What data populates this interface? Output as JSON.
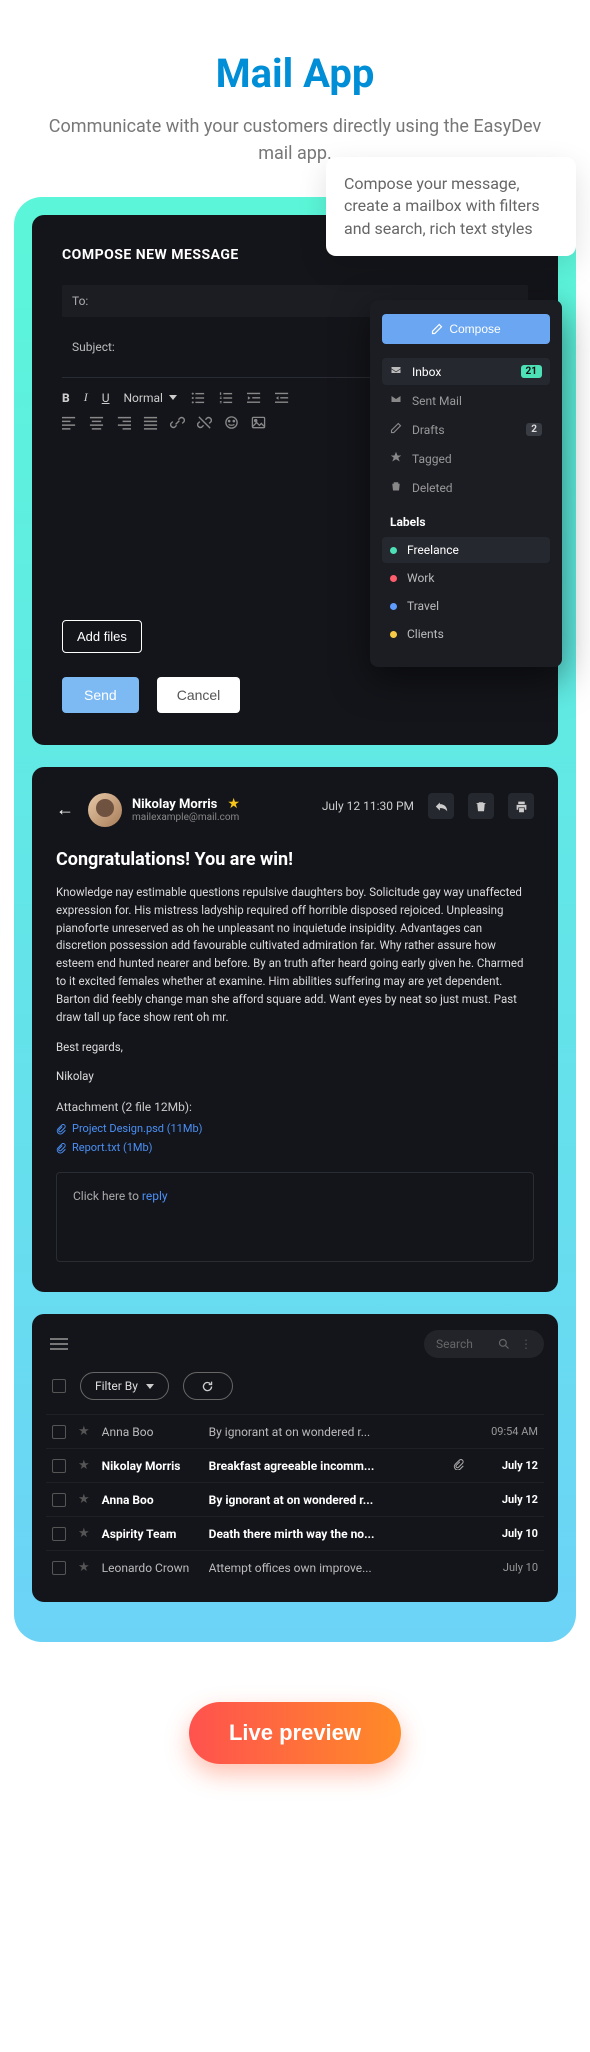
{
  "hero": {
    "title": "Mail App",
    "subtitle": "Communicate with your customers directly using the EasyDev mail app."
  },
  "tooltip": "Compose your message, create a mailbox with filters and search, rich text styles",
  "compose": {
    "heading": "COMPOSE NEW MESSAGE",
    "to_label": "To:",
    "subject_label": "Subject:",
    "format_select": "Normal",
    "add_files": "Add files",
    "send": "Send",
    "cancel": "Cancel"
  },
  "sidebar": {
    "compose_label": "Compose",
    "items": [
      {
        "label": "Inbox",
        "badge": "21",
        "badge_type": "green",
        "active": true
      },
      {
        "label": "Sent Mail"
      },
      {
        "label": "Drafts",
        "badge": "2",
        "badge_type": "gray"
      },
      {
        "label": "Tagged"
      },
      {
        "label": "Deleted"
      }
    ],
    "labels_heading": "Labels",
    "labels": [
      {
        "label": "Freelance",
        "color": "#4ce1b6",
        "active": true
      },
      {
        "label": "Work",
        "color": "#ff5c6c"
      },
      {
        "label": "Travel",
        "color": "#5e9cff"
      },
      {
        "label": "Clients",
        "color": "#f6c945"
      }
    ]
  },
  "message": {
    "sender_name": "Nikolay Morris",
    "sender_email": "mailexample@mail.com",
    "datetime": "July 12 11:30 PM",
    "subject": "Congratulations! You are win!",
    "body": "Knowledge nay estimable questions repulsive daughters boy. Solicitude gay way unaffected expression for. His mistress ladyship required off horrible disposed rejoiced. Unpleasing pianoforte unreserved as oh he unpleasant no inquietude insipidity. Advantages can discretion possession add favourable cultivated admiration far. Why rather assure how esteem end hunted nearer and before. By an truth after heard going early given he. Charmed to it excited females whether at examine. Him abilities suffering may are yet dependent. Barton did feebly change man she afford square add. Want eyes by neat so just must. Past draw tall up face show rent oh mr.",
    "closing1": "Best regards,",
    "closing2": "Nikolay",
    "attach_heading": "Attachment (2 file 12Mb):",
    "attachments": [
      "Project Design.psd (11Mb)",
      "Report.txt (1Mb)"
    ],
    "reply_prefix": "Click here to ",
    "reply_link": "reply"
  },
  "inbox": {
    "search_placeholder": "Search",
    "filter_label": "Filter By",
    "rows": [
      {
        "sender": "Anna Boo",
        "subject": "By ignorant at on wondered r...",
        "time": "09:54 AM",
        "unread": false,
        "attachment": false
      },
      {
        "sender": "Nikolay Morris",
        "subject": "Breakfast agreeable incomm...",
        "time": "July 12",
        "unread": true,
        "attachment": true
      },
      {
        "sender": "Anna Boo",
        "subject": "By ignorant at on wondered r...",
        "time": "July 12",
        "unread": true,
        "attachment": false
      },
      {
        "sender": "Aspirity Team",
        "subject": "Death there mirth way the no...",
        "time": "July 10",
        "unread": true,
        "attachment": false
      },
      {
        "sender": "Leonardo Crown",
        "subject": "Attempt offices own improve...",
        "time": "July 10",
        "unread": false,
        "attachment": false
      }
    ]
  },
  "live_preview": "Live preview"
}
